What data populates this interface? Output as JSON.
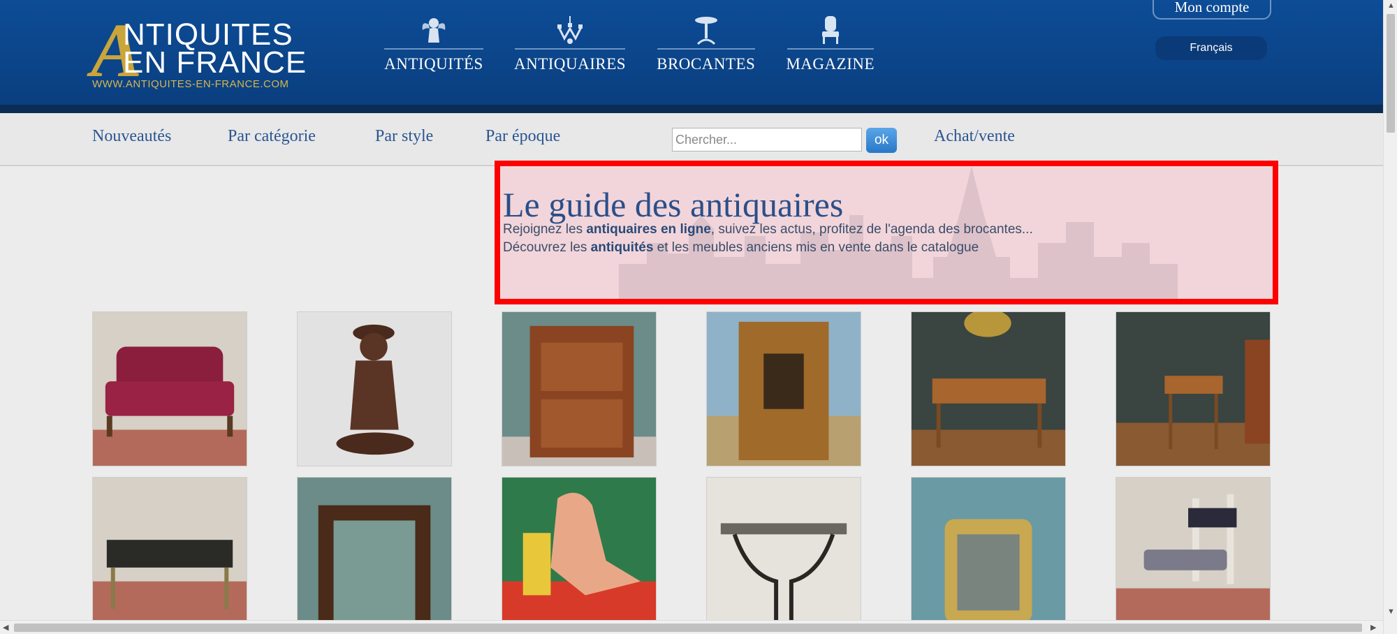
{
  "header": {
    "logo": {
      "letter": "A",
      "line1": "NTIQUITES",
      "line2": "EN FRANCE",
      "url": "WWW.ANTIQUITES-EN-FRANCE.COM"
    },
    "nav": [
      {
        "label": "ANTIQUITÉS",
        "icon": "cherub-icon"
      },
      {
        "label": "ANTIQUAIRES",
        "icon": "chandelier-icon"
      },
      {
        "label": "BROCANTES",
        "icon": "gueridon-table-icon"
      },
      {
        "label": "MAGAZINE",
        "icon": "armchair-icon"
      }
    ],
    "account_label": "Mon compte",
    "language": "Français"
  },
  "subnav": {
    "links": [
      "Nouveautés",
      "Par catégorie",
      "Par style",
      "Par époque"
    ],
    "search_placeholder": "Chercher...",
    "search_button": "ok",
    "buy_sell": "Achat/vente"
  },
  "intro": {
    "title": "Le guide des antiquaires",
    "line1_a": "Rejoignez les ",
    "line1_b": "antiquaires en ligne",
    "line1_c": ", suivez les actus, profitez de l'agenda des brocantes...",
    "line2_a": "Découvrez les ",
    "line2_b": "antiquités",
    "line2_c": " et les meubles anciens mis en vente dans le catalogue"
  },
  "colors": {
    "header_blue": "#0d4c96",
    "gold": "#c9a53b",
    "link_blue": "#2a5592",
    "highlight_red": "#ff0000"
  },
  "products": [
    {
      "name": "red-settee-photo"
    },
    {
      "name": "bronze-statue-photo"
    },
    {
      "name": "marquetry-secretary-photo"
    },
    {
      "name": "carved-hall-cabinet-photo"
    },
    {
      "name": "writing-desk-photo"
    },
    {
      "name": "side-table-photo"
    },
    {
      "name": "low-table-photo"
    },
    {
      "name": "carved-frame-photo"
    },
    {
      "name": "nude-painting-photo"
    },
    {
      "name": "wrought-iron-console-photo"
    },
    {
      "name": "gilt-mirror-photo"
    },
    {
      "name": "chair-photo"
    }
  ]
}
